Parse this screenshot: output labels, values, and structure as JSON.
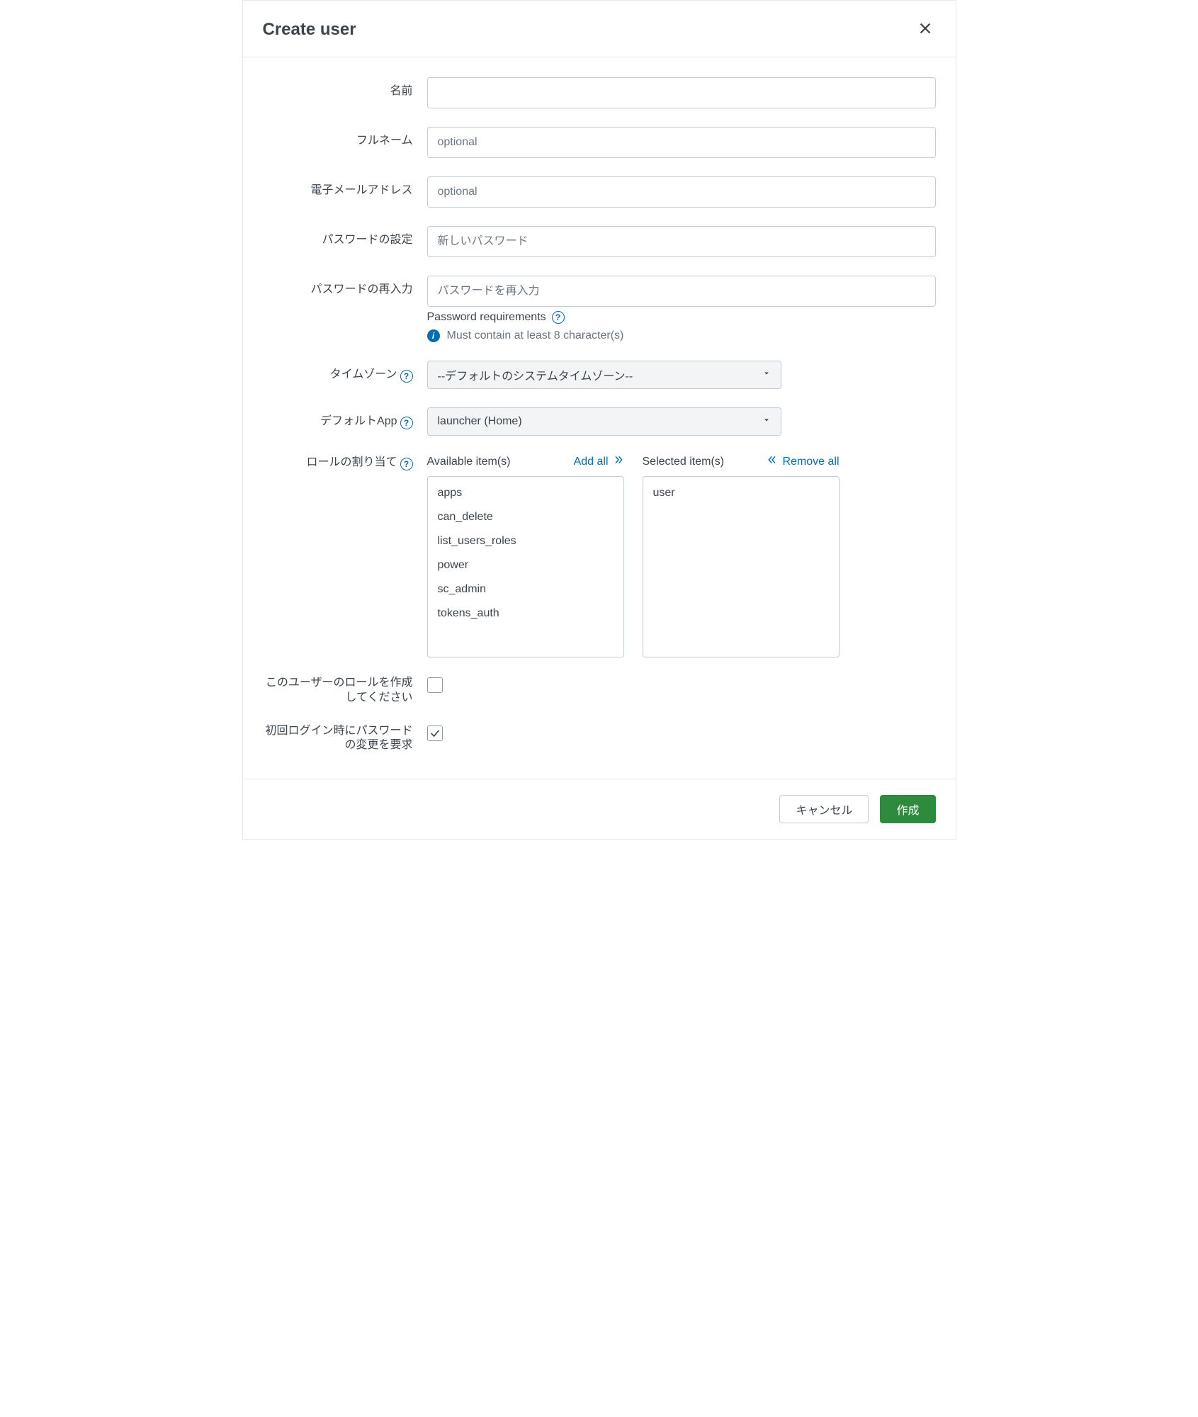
{
  "header": {
    "title": "Create user"
  },
  "fields": {
    "name_label": "名前",
    "fullname_label": "フルネーム",
    "fullname_placeholder": "optional",
    "email_label": "電子メールアドレス",
    "email_placeholder": "optional",
    "password_label": "パスワードの設定",
    "password_placeholder": "新しいパスワード",
    "password_confirm_label": "パスワードの再入力",
    "password_confirm_placeholder": "パスワードを再入力",
    "password_req_title": "Password requirements",
    "password_req_rule": "Must contain at least 8 character(s)",
    "timezone_label": "タイムゾーン",
    "timezone_value": "--デフォルトのシステムタイムゾーン--",
    "default_app_label": "デフォルトApp",
    "default_app_value": "launcher (Home)",
    "roles_label": "ロールの割り当て"
  },
  "roles": {
    "available_title": "Available item(s)",
    "add_all_label": "Add all",
    "selected_title": "Selected item(s)",
    "remove_all_label": "Remove all",
    "available_items": [
      "apps",
      "can_delete",
      "list_users_roles",
      "power",
      "sc_admin",
      "tokens_auth"
    ],
    "selected_items": [
      "user"
    ]
  },
  "checkboxes": {
    "create_role_label": "このユーザーのロールを作成してください",
    "create_role_checked": false,
    "require_pw_change_label": "初回ログイン時にパスワードの変更を要求",
    "require_pw_change_checked": true
  },
  "footer": {
    "cancel_label": "キャンセル",
    "submit_label": "作成"
  }
}
